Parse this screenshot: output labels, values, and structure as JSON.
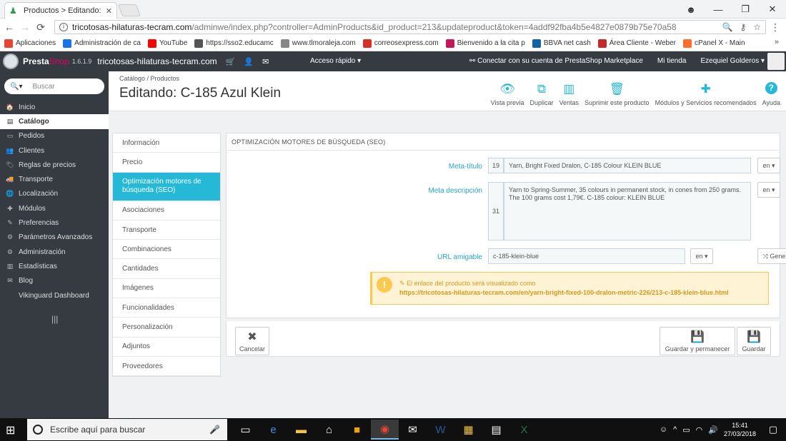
{
  "browser": {
    "tab_title": "Productos > Editando: C",
    "tab_close": "✕",
    "url_host": "tricotosas-hilaturas-tecram.com",
    "url_path": "/adminwe/index.php?controller=AdminProducts&id_product=213&updateproduct&token=4addf92fba4b5e4827e0879b75e70a58",
    "bookmarks": [
      {
        "label": "Aplicaciones",
        "color": "#e94335"
      },
      {
        "label": "Administración de ca",
        "color": "#1a73e8"
      },
      {
        "label": "YouTube",
        "color": "#ff0000"
      },
      {
        "label": "https://sso2.educamc",
        "color": "#555555"
      },
      {
        "label": "www.tlmoraleja.com",
        "color": "#888888"
      },
      {
        "label": "correosexpress.com",
        "color": "#d93025"
      },
      {
        "label": "Bienvenido a la cita p",
        "color": "#c2185b"
      },
      {
        "label": "BBVA net cash",
        "color": "#1464a5"
      },
      {
        "label": "Área Cliente - Weber",
        "color": "#c62828"
      },
      {
        "label": "cPanel X - Main",
        "color": "#ff6c2c"
      }
    ],
    "bookmarks_more": "»"
  },
  "header": {
    "logo_presta": "Presta",
    "logo_shop": "Shop",
    "version": "1.6.1.9",
    "shop_name": "tricotosas-hilaturas-tecram.com",
    "quick_access": "Acceso rápido ▾",
    "marketplace": "Conectar con su cuenta de PrestaShop Marketplace",
    "my_shop": "Mi tienda",
    "user": "Ezequiel Golderos ▾"
  },
  "sidebar": {
    "search_placeholder": "Buscar",
    "items": [
      {
        "label": "Inicio",
        "icon": "🏠"
      },
      {
        "label": "Catálogo",
        "icon": "▤"
      },
      {
        "label": "Pedidos",
        "icon": "▭"
      },
      {
        "label": "Clientes",
        "icon": "👥"
      },
      {
        "label": "Reglas de precios",
        "icon": "🏷"
      },
      {
        "label": "Transporte",
        "icon": "🚚"
      },
      {
        "label": "Localización",
        "icon": "🌐"
      },
      {
        "label": "Módulos",
        "icon": "✚"
      },
      {
        "label": "Preferencias",
        "icon": "✎"
      },
      {
        "label": "Parámetros Avanzados",
        "icon": "⚙"
      },
      {
        "label": "Administración",
        "icon": "⚙"
      },
      {
        "label": "Estadísticas",
        "icon": "▥"
      },
      {
        "label": "Blog",
        "icon": "✉"
      },
      {
        "label": "Vikinguard Dashboard",
        "icon": ""
      }
    ],
    "collapse_icon": "|||"
  },
  "page": {
    "breadcrumb": "Catálogo  /  Productos",
    "title": "Editando: C-185 Azul Klein",
    "toolbar": [
      {
        "label": "Vista previa",
        "icon": "👁"
      },
      {
        "label": "Duplicar",
        "icon": "⧉"
      },
      {
        "label": "Ventas",
        "icon": "▥"
      },
      {
        "label": "Suprimir este producto",
        "icon": "🗑"
      },
      {
        "label": "Módulos y Servicios recomendados",
        "icon": "✚"
      },
      {
        "label": "Ayuda",
        "icon": "?"
      }
    ]
  },
  "product_tabs": [
    "Información",
    "Precio",
    "Optimización motores de búsqueda (SEO)",
    "Asociaciones",
    "Transporte",
    "Combinaciones",
    "Cantidades",
    "Imágenes",
    "Funcionalidades",
    "Personalización",
    "Adjuntos",
    "Proveedores"
  ],
  "seo": {
    "panel_title": "OPTIMIZACIÓN MOTORES DE BÚSQUEDA (SEO)",
    "meta_title_label": "Meta-título",
    "meta_title_count": "19",
    "meta_title_value": "Yarn, Bright Fixed Dralon, C-185  Colour KLEIN BLUE",
    "meta_desc_label": "Meta descripción",
    "meta_desc_count": "31",
    "meta_desc_value": "Yarn to Spring-Summer, 35 colours in permanent stock, in cones from 250 grams. The 100 grams cost 1,79€. C-185 colour: KLEIN BLUE",
    "url_label": "URL amigable",
    "url_value": "c-185-klein-blue",
    "lang": "en ▾",
    "generate": "⤨ Generar",
    "warning_text": "✎ El enlace del producto será visualizado como",
    "warning_link": "https://tricotosas-hilaturas-tecram.com/en/yarn-bright-fixed-100-dralon-metric-226/213-c-185-klein-blue.html"
  },
  "footer": {
    "cancel": "Cancelar",
    "save_stay": "Guardar y permanecer",
    "save": "Guardar"
  },
  "taskbar": {
    "search_placeholder": "Escribe aquí para buscar",
    "time": "15:41",
    "date": "27/03/2018"
  }
}
